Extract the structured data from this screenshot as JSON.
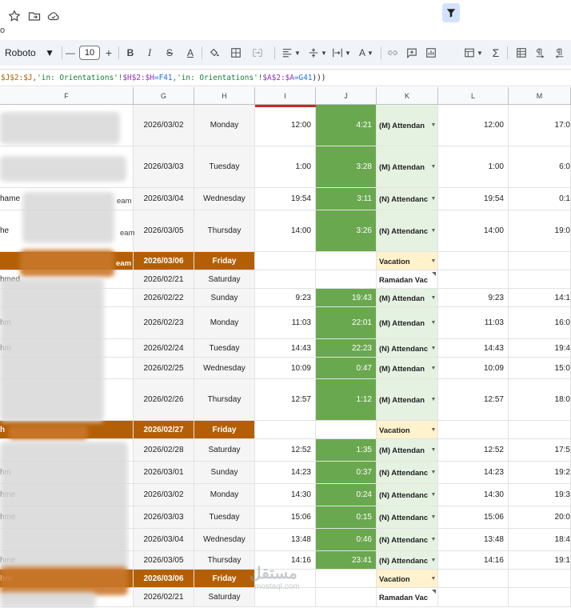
{
  "topbar": {
    "icons": [
      "star-icon",
      "move-to-folder-icon",
      "cloud-saved-icon"
    ],
    "stub_label": "o"
  },
  "toolbar": {
    "font_name": "Roboto",
    "font_size": "10",
    "minus": "—",
    "plus": "+",
    "bold": "B",
    "italic": "I",
    "strike": "S",
    "text_color": "A",
    "text_rotation": "A",
    "functions": "Σ"
  },
  "formula": {
    "part1": "$J$2:$J",
    "part2": ",'in: Orientations'!",
    "part3": "$H$2:$H",
    "part4": "=F41",
    "part5": ",'in: Orientations'!",
    "part6": "$A$2:$A",
    "part7": "=G41",
    "part8": ")))"
  },
  "columns": [
    "F",
    "G",
    "H",
    "I",
    "J",
    "K",
    "L",
    "M"
  ],
  "colors": {
    "green_cell": "#6aa84f",
    "holiday": "#b45f06",
    "vacation": "#fff2cc",
    "status_col": "#e6f2e1"
  },
  "rows": [
    {
      "f": "",
      "g": "2026/03/02",
      "h": "Monday",
      "i": "12:00",
      "j": "4:21",
      "k": "(M) Attendan",
      "l": "12:00",
      "m": "17:0",
      "type": "work"
    },
    {
      "f": "",
      "g": "2026/03/03",
      "h": "Tuesday",
      "i": "1:00",
      "j": "3:28",
      "k": "(M) Attendan",
      "l": "1:00",
      "m": "6:0",
      "type": "work"
    },
    {
      "f": "hame",
      "g": "2026/03/04",
      "h": "Wednesday",
      "i": "19:54",
      "j": "3:11",
      "k": "(N) Attendanc",
      "l": "19:54",
      "m": "0:1",
      "type": "work"
    },
    {
      "f": "he",
      "g": "2026/03/05",
      "h": "Thursday",
      "i": "14:00",
      "j": "3:26",
      "k": "(N) Attendanc",
      "l": "14:00",
      "m": "19:0",
      "type": "work"
    },
    {
      "f": "",
      "g": "2026/03/06",
      "h": "Friday",
      "i": "",
      "j": "",
      "k": "Vacation",
      "l": "",
      "m": "",
      "type": "holiday"
    },
    {
      "f": "hmed",
      "g": "2026/02/21",
      "h": "Saturday",
      "i": "",
      "j": "",
      "k": "Ramadan Vac",
      "l": "",
      "m": "",
      "type": "ramadan"
    },
    {
      "f": "",
      "g": "2026/02/22",
      "h": "Sunday",
      "i": "9:23",
      "j": "19:43",
      "k": "(M) Attendan",
      "l": "9:23",
      "m": "14:1",
      "type": "work"
    },
    {
      "f": "hm",
      "g": "2026/02/23",
      "h": "Monday",
      "i": "11:03",
      "j": "22:01",
      "k": "(M) Attendan",
      "l": "11:03",
      "m": "16:0",
      "type": "work"
    },
    {
      "f": "hm",
      "g": "2026/02/24",
      "h": "Tuesday",
      "i": "14:43",
      "j": "22:23",
      "k": "(N) Attendanc",
      "l": "14:43",
      "m": "19:4",
      "type": "work"
    },
    {
      "f": "",
      "g": "2026/02/25",
      "h": "Wednesday",
      "i": "10:09",
      "j": "0:47",
      "k": "(M) Attendan",
      "l": "10:09",
      "m": "15:0",
      "type": "work"
    },
    {
      "f": "",
      "g": "2026/02/26",
      "h": "Thursday",
      "i": "12:57",
      "j": "1:12",
      "k": "(M) Attendan",
      "l": "12:57",
      "m": "18:0",
      "type": "work"
    },
    {
      "f": "h",
      "g": "2026/02/27",
      "h": "Friday",
      "i": "",
      "j": "",
      "k": "Vacation",
      "l": "",
      "m": "",
      "type": "holiday"
    },
    {
      "f": "",
      "g": "2026/02/28",
      "h": "Saturday",
      "i": "12:52",
      "j": "1:35",
      "k": "(M) Attendan",
      "l": "12:52",
      "m": "17:5",
      "type": "work"
    },
    {
      "f": "hm",
      "g": "2026/03/01",
      "h": "Sunday",
      "i": "14:23",
      "j": "0:37",
      "k": "(N) Attendanc",
      "l": "14:23",
      "m": "19:2",
      "type": "work"
    },
    {
      "f": "hme",
      "g": "2026/03/02",
      "h": "Monday",
      "i": "14:30",
      "j": "0:24",
      "k": "(N) Attendanc",
      "l": "14:30",
      "m": "19:3",
      "type": "work"
    },
    {
      "f": "hme",
      "g": "2026/03/03",
      "h": "Tuesday",
      "i": "15:06",
      "j": "0:15",
      "k": "(N) Attendanc",
      "l": "15:06",
      "m": "20:0",
      "type": "work"
    },
    {
      "f": "",
      "g": "2026/03/04",
      "h": "Wednesday",
      "i": "13:48",
      "j": "0:46",
      "k": "(N) Attendanc",
      "l": "13:48",
      "m": "18:4",
      "type": "work"
    },
    {
      "f": "hme",
      "g": "2026/03/05",
      "h": "Thursday",
      "i": "14:16",
      "j": "23:41",
      "k": "(N) Attendanc",
      "l": "14:16",
      "m": "19:1",
      "type": "work"
    },
    {
      "f": "hm",
      "g": "2026/03/06",
      "h": "Friday",
      "i": "",
      "j": "",
      "k": "Vacation",
      "l": "",
      "m": "",
      "type": "holiday"
    },
    {
      "f": "",
      "g": "2026/02/21",
      "h": "Saturday",
      "i": "",
      "j": "",
      "k": "Ramadan Vac",
      "l": "",
      "m": "",
      "type": "ramadan"
    }
  ],
  "leaks": {
    "eam1": "eam",
    "eam2": "eam",
    "eam3": "eam"
  },
  "watermark": {
    "arabic": "مستقل",
    "latin": "mostaql.com"
  }
}
